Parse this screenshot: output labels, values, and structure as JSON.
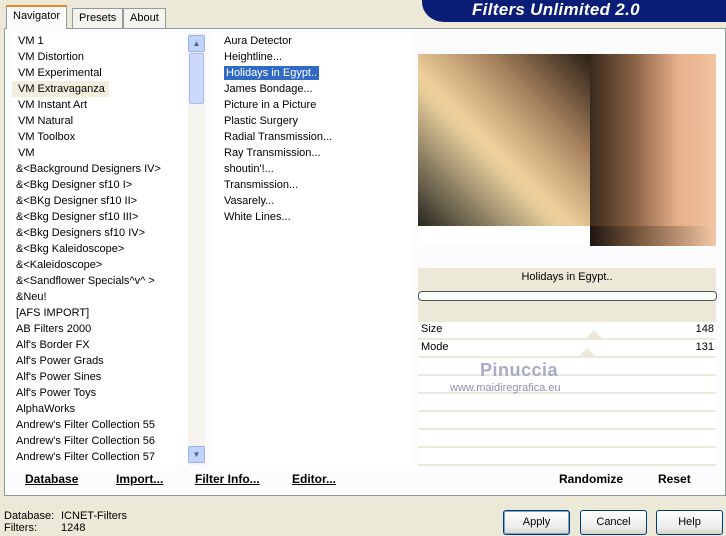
{
  "tabs": [
    "Navigator",
    "Presets",
    "About"
  ],
  "banner": {
    "title": "Filters Unlimited 2.0"
  },
  "categories": [
    {
      "label": "VM 1",
      "indent": true
    },
    {
      "label": "VM Distortion",
      "indent": true
    },
    {
      "label": "VM Experimental",
      "indent": true
    },
    {
      "label": "VM Extravaganza",
      "indent": true,
      "selected": true
    },
    {
      "label": "VM Instant Art",
      "indent": true
    },
    {
      "label": "VM Natural",
      "indent": true
    },
    {
      "label": "VM Toolbox",
      "indent": true
    },
    {
      "label": "VM",
      "indent": true
    },
    {
      "label": "&<Background Designers IV>"
    },
    {
      "label": "&<Bkg Designer sf10 I>"
    },
    {
      "label": "&<BKg Designer sf10 II>"
    },
    {
      "label": "&<Bkg Designer sf10 III>"
    },
    {
      "label": "&<Bkg Designers sf10 IV>"
    },
    {
      "label": "&<Bkg Kaleidoscope>"
    },
    {
      "label": "&<Kaleidoscope>"
    },
    {
      "label": "&<Sandflower Specials^v^ >"
    },
    {
      "label": "&Neu!"
    },
    {
      "label": "[AFS IMPORT]"
    },
    {
      "label": "AB Filters 2000"
    },
    {
      "label": "Alf's Border FX"
    },
    {
      "label": "Alf's Power Grads"
    },
    {
      "label": "Alf's Power Sines"
    },
    {
      "label": "Alf's Power Toys"
    },
    {
      "label": "AlphaWorks"
    },
    {
      "label": "Andrew's Filter Collection 55"
    },
    {
      "label": "Andrew's Filter Collection 56"
    },
    {
      "label": "Andrew's Filter Collection 57"
    }
  ],
  "scroll": {
    "up": "▲",
    "down": "▼"
  },
  "filters": [
    {
      "label": "Aura Detector"
    },
    {
      "label": "Heightline..."
    },
    {
      "label": "Holidays in Egypt..",
      "selected": true
    },
    {
      "label": "James Bondage..."
    },
    {
      "label": "Picture in a Picture"
    },
    {
      "label": "Plastic Surgery"
    },
    {
      "label": "Radial Transmission..."
    },
    {
      "label": "Ray Transmission..."
    },
    {
      "label": "shoutin'!..."
    },
    {
      "label": "Transmission..."
    },
    {
      "label": "Vasarely..."
    },
    {
      "label": "White Lines..."
    }
  ],
  "current_filter": "Holidays in Egypt..",
  "params": [
    {
      "label": "Size",
      "value": "148"
    },
    {
      "label": "Mode",
      "value": "131"
    }
  ],
  "watermark": {
    "name": "Pinuccia",
    "site": "www.maidiregrafica.eu"
  },
  "bottom_buttons": {
    "database": "Database",
    "import": "Import...",
    "filter_info": "Filter Info...",
    "editor": "Editor...",
    "randomize": "Randomize",
    "reset": "Reset"
  },
  "status": {
    "database_label": "Database:",
    "database_value": "ICNET-Filters",
    "filters_label": "Filters:",
    "filters_value": "1248"
  },
  "buttons": {
    "apply": "Apply",
    "cancel": "Cancel",
    "help": "Help"
  }
}
